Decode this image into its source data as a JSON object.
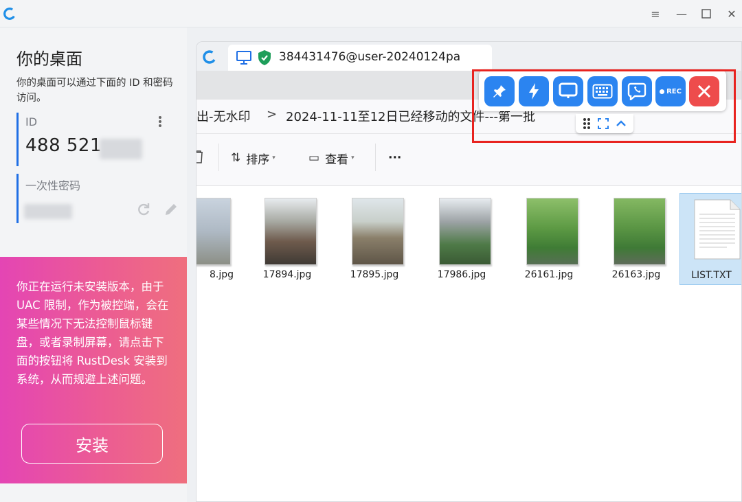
{
  "window": {
    "controls": [
      "menu",
      "minimize",
      "maximize",
      "close"
    ]
  },
  "left_panel": {
    "title": "你的桌面",
    "subtitle": "你的桌面可以通过下面的 ID 和密码访问。",
    "id_label": "ID",
    "id_value": "488 521",
    "password_label": "一次性密码",
    "install_notice": "你正在运行未安装版本，由于 UAC 限制，作为被控端，会在某些情况下无法控制鼠标键盘，或者录制屏幕，请点击下面的按钮将 RustDesk 安装到系统，从而规避上述问题。",
    "install_button": "安装"
  },
  "remote": {
    "tab_title": "384431476@user-20240124pa",
    "breadcrumb": [
      "出-无水印",
      ">",
      "2024-11-11至12日已经移动的文件---第一批"
    ],
    "commands": [
      {
        "label": "排序"
      },
      {
        "label": "查看"
      },
      {
        "label": "···"
      }
    ],
    "files": [
      {
        "name": "8.jpg"
      },
      {
        "name": "17894.jpg"
      },
      {
        "name": "17895.jpg"
      },
      {
        "name": "17986.jpg"
      },
      {
        "name": "26161.jpg"
      },
      {
        "name": "26163.jpg"
      },
      {
        "name": "LIST.TXT"
      }
    ]
  },
  "toolbar": {
    "buttons": [
      "pin-icon",
      "lightning-icon",
      "display-icon",
      "keyboard-icon",
      "chat-icon",
      "record-icon",
      "close-icon"
    ],
    "rec_label": "REC",
    "accent": "#2b84f0",
    "close_color": "#ee4c4c",
    "highlight_color": "#e8231f"
  }
}
